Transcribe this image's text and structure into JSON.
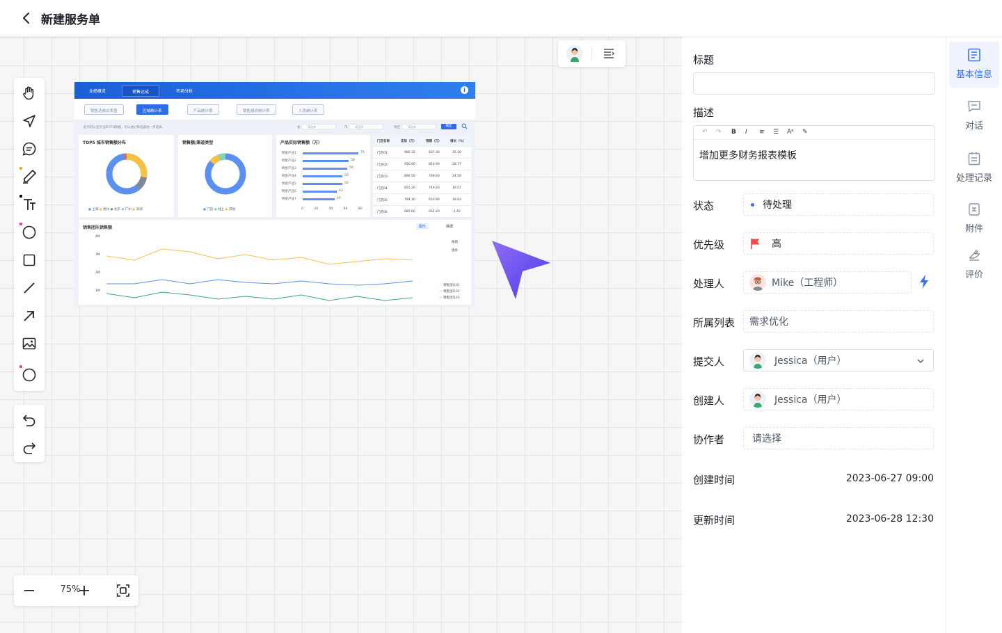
{
  "header": {
    "title": "新建服务单"
  },
  "canvas": {
    "zoom": "75%",
    "dashboard": {
      "nav_tabs": [
        "业绩概览",
        "销售达成",
        "市场分析"
      ],
      "sub_tabs": [
        "销售达成仪表盘",
        "区域统计表",
        "产品统计表",
        "销售组织统计表",
        "人员统计表"
      ],
      "filter_note": "此页默认显示当年YTD数据，可以通过筛选器进一步选择。",
      "filter_labels": [
        "省",
        "市",
        "地区"
      ],
      "filter_placeholder": "请选择",
      "filter_ok": "确定",
      "card1_title": "TOP5 城市销售额分布",
      "card1_legend": [
        "上海",
        "杭州",
        "北京",
        "广州",
        "深圳"
      ],
      "card2_title": "销售额/渠道类型",
      "card2_legend": [
        "门店",
        "线上",
        "其他"
      ],
      "card3_title": "产品实际销售额（万）",
      "products": [
        {
          "name": "明星产品1",
          "value": "70"
        },
        {
          "name": "明星产品2",
          "value": "58"
        },
        {
          "name": "明星产品3",
          "value": "56"
        },
        {
          "name": "明星产品4",
          "value": "50"
        },
        {
          "name": "明星产品5",
          "value": "50"
        },
        {
          "name": "明星产品6",
          "value": "43"
        },
        {
          "name": "明星产品7",
          "value": "40"
        }
      ],
      "product_axis": [
        "0",
        "20",
        "40",
        "60",
        "80"
      ],
      "table_head": [
        "门店名称",
        "实际（万）",
        "预期（万）",
        "增长（%）"
      ],
      "table_rows": [
        [
          "门店01",
          "980.32",
          "837.30",
          "35.30"
        ],
        [
          "门店02",
          "956.90",
          "850.90",
          "28.77"
        ],
        [
          "门店03",
          "890.50",
          "799.60",
          "24.56"
        ],
        [
          "门店04",
          "855.20",
          "749.20",
          "19.57"
        ],
        [
          "门店05",
          "794.10",
          "650.90",
          "18.63"
        ],
        [
          "门店06",
          "685.60",
          "635.20",
          "-1.20"
        ]
      ],
      "line_title": "销售团队销售额",
      "line_toggle": [
        "图形",
        "数据"
      ],
      "line_radio": [
        "按周",
        "逐条"
      ],
      "line_legend": [
        "销售团队01",
        "销售团队02",
        "销售团队03"
      ],
      "line_yaxis": [
        "4M",
        "3M",
        "2M",
        "1M"
      ]
    }
  },
  "form": {
    "title_label": "标题",
    "title_value": "",
    "desc_label": "描述",
    "desc_value": "增加更多财务报表模板",
    "status_label": "状态",
    "status_value": "待处理",
    "priority_label": "优先级",
    "priority_value": "高",
    "assignee_label": "处理人",
    "assignee_value": "Mike（工程师）",
    "list_label": "所属列表",
    "list_value": "需求优化",
    "submitter_label": "提交人",
    "submitter_value": "Jessica（用户）",
    "creator_label": "创建人",
    "creator_value": "Jessica（用户）",
    "collab_label": "协作者",
    "collab_placeholder": "请选择",
    "created_label": "创建时间",
    "created_value": "2023-06-27 09:00",
    "updated_label": "更新时间",
    "updated_value": "2023-06-28 12:30"
  },
  "sidenav": {
    "items": [
      {
        "label": "基本信息",
        "icon": "info-card-icon"
      },
      {
        "label": "对话",
        "icon": "chat-icon"
      },
      {
        "label": "处理记录",
        "icon": "record-icon"
      },
      {
        "label": "附件",
        "icon": "attachment-icon"
      },
      {
        "label": "评价",
        "icon": "rate-icon"
      }
    ]
  },
  "colors": {
    "accent": "#3370ff",
    "priority": "#f54a45"
  }
}
